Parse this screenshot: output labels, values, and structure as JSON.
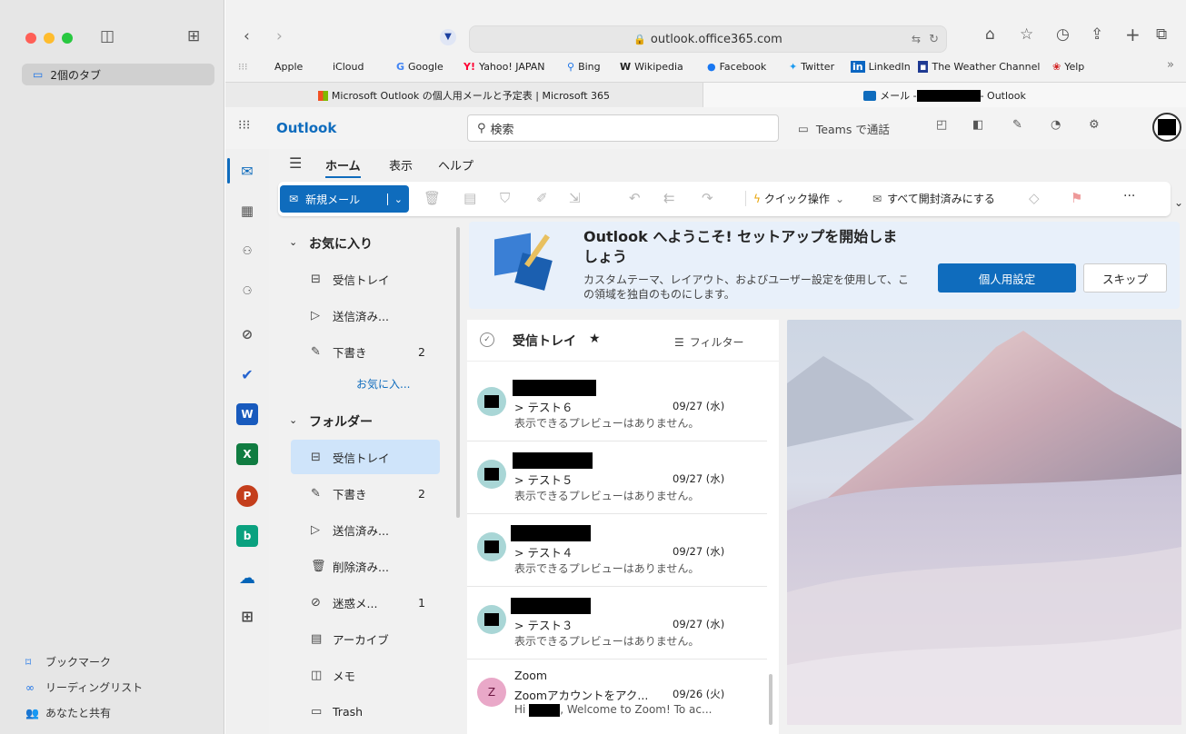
{
  "safari": {
    "tab_group_label": "2個のタブ",
    "sidebar_bottom": [
      {
        "icon": "bookmark-icon",
        "label": "ブックマーク"
      },
      {
        "icon": "reading-list-icon",
        "label": "リーディングリスト"
      },
      {
        "icon": "shared-with-you-icon",
        "label": "あなたと共有"
      }
    ],
    "url": "outlook.office365.com",
    "favorites": [
      "Apple",
      "iCloud",
      "Google",
      "Yahoo! JAPAN",
      "Bing",
      "Wikipedia",
      "Facebook",
      "Twitter",
      "LinkedIn",
      "The Weather Channel",
      "Yelp"
    ],
    "tabs": [
      {
        "title": "Microsoft Outlook の個人用メールと予定表 | Microsoft 365"
      },
      {
        "title_prefix": "メール - ",
        "title_suffix": " - Outlook"
      }
    ]
  },
  "outlook": {
    "app_name": "Outlook",
    "search_placeholder": "検索",
    "teams_call": "Teams で通話",
    "ribbon_tabs": [
      "ホーム",
      "表示",
      "ヘルプ"
    ],
    "new_mail": "新規メール",
    "quick_steps": "クイック操作",
    "mark_all_read": "すべて開封済みにする",
    "more": "···",
    "favorites_header": "お気に入り",
    "favorites": [
      {
        "icon": "inbox-icon",
        "label": "受信トレイ",
        "count": ""
      },
      {
        "icon": "send-icon",
        "label": "送信済み...",
        "count": ""
      },
      {
        "icon": "draft-icon",
        "label": "下書き",
        "count": "2"
      }
    ],
    "favorites_add": "お気に入...",
    "folders_header": "フォルダー",
    "folders": [
      {
        "icon": "inbox-icon",
        "label": "受信トレイ",
        "count": ""
      },
      {
        "icon": "draft-icon",
        "label": "下書き",
        "count": "2"
      },
      {
        "icon": "send-icon",
        "label": "送信済み...",
        "count": ""
      },
      {
        "icon": "trash-icon",
        "label": "削除済み...",
        "count": ""
      },
      {
        "icon": "junk-icon",
        "label": "迷惑メ...",
        "count": "1"
      },
      {
        "icon": "archive-icon",
        "label": "アーカイブ",
        "count": ""
      },
      {
        "icon": "note-icon",
        "label": "メモ",
        "count": ""
      },
      {
        "icon": "folder-icon",
        "label": "Trash",
        "count": ""
      }
    ],
    "banner": {
      "title": "Outlook へようこそ! セットアップを開始しましょう",
      "text": "カスタムテーマ、レイアウト、およびユーザー設定を使用して、この領域を独自のものにします。",
      "primary": "個人用設定",
      "secondary": "スキップ"
    },
    "list": {
      "title": "受信トレイ",
      "filter": "フィルター",
      "messages": [
        {
          "subject": "> テスト６",
          "date": "09/27 (水)",
          "preview": "表示できるプレビューはありません。"
        },
        {
          "subject": "> テスト５",
          "date": "09/27 (水)",
          "preview": "表示できるプレビューはありません。"
        },
        {
          "subject": "> テスト４",
          "date": "09/27 (水)",
          "preview": "表示できるプレビューはありません。"
        },
        {
          "subject": "> テスト３",
          "date": "09/27 (水)",
          "preview": "表示できるプレビューはありません。"
        },
        {
          "sender": "Zoom",
          "avatar": "Z",
          "subject": "Zoomアカウントをアク...",
          "date": "09/26 (火)",
          "preview_prefix": "Hi",
          "preview_suffix": ", Welcome to Zoom! To ac..."
        }
      ]
    }
  }
}
